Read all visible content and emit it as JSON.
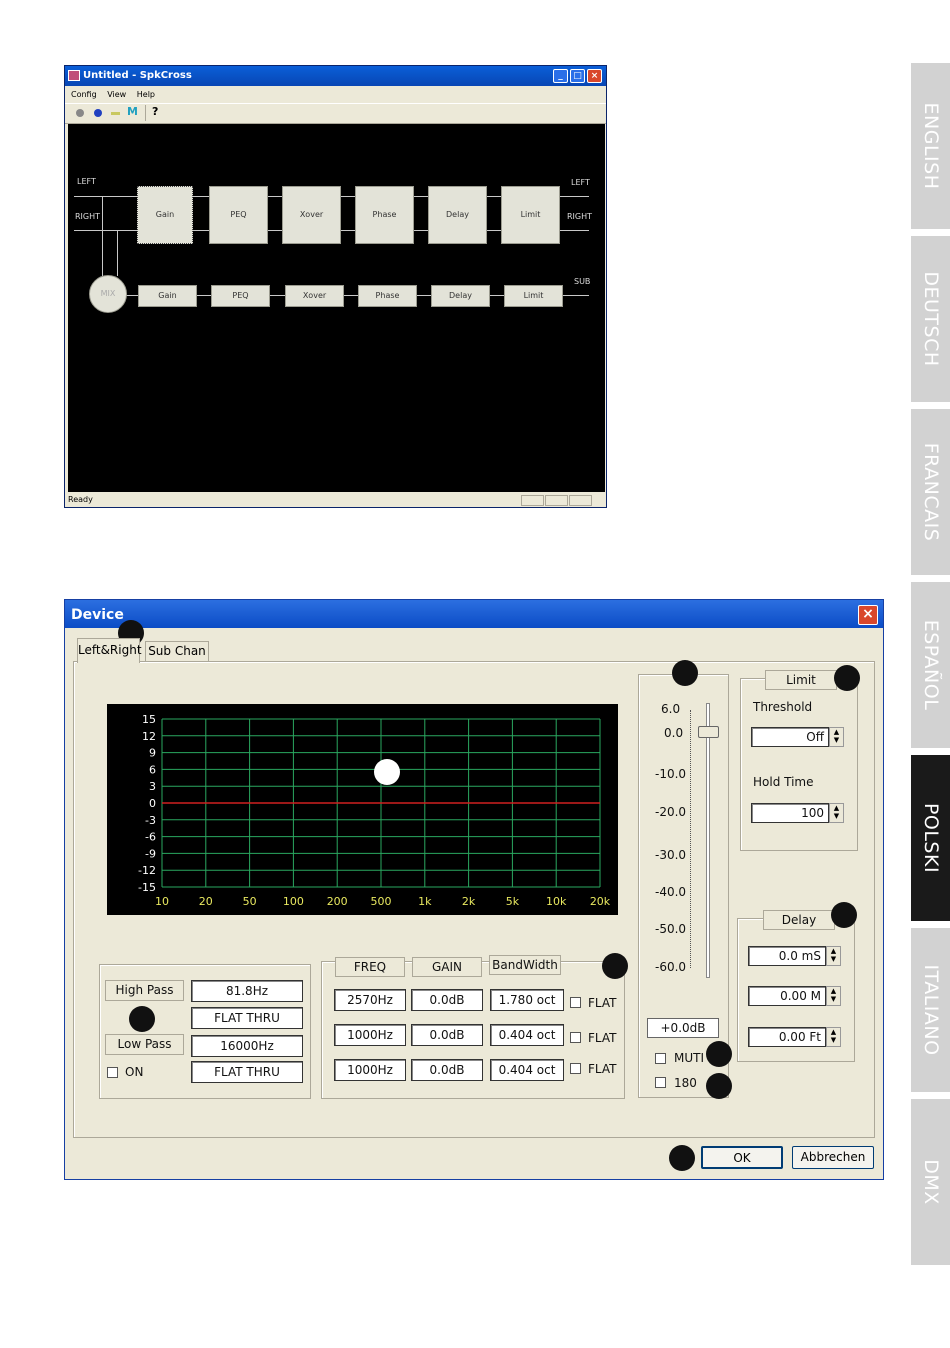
{
  "window1": {
    "title": "Untitled - SpkCross",
    "menu": [
      "Config",
      "View",
      "Help"
    ],
    "toolbar_icons": [
      "gray-circle-icon",
      "blue-circle-icon",
      "yellow-bar-icon",
      "m-icon",
      "help-icon"
    ],
    "labels": {
      "left_in": "LEFT",
      "right_in": "RIGHT",
      "left_out": "LEFT",
      "right_out": "RIGHT",
      "sub_out": "SUB",
      "mix": "MIX"
    },
    "main_chain": [
      "Gain",
      "PEQ",
      "Xover",
      "Phase",
      "Delay",
      "Limit"
    ],
    "sub_chain": [
      "Gain",
      "PEQ",
      "Xover",
      "Phase",
      "Delay",
      "Limit"
    ],
    "status": "Ready"
  },
  "device": {
    "title": "Device",
    "tabs": [
      "Left&Right",
      "Sub Chan"
    ],
    "graph": {
      "y_ticks": [
        "15",
        "12",
        "9",
        "6",
        "3",
        "0",
        "-3",
        "-6",
        "-9",
        "-12",
        "-15"
      ],
      "x_ticks": [
        "10",
        "20",
        "50",
        "100",
        "200",
        "500",
        "1k",
        "2k",
        "5k",
        "10k",
        "20k"
      ],
      "curve_color": "#d02020",
      "grid_color": "#2aa860"
    },
    "filters": {
      "high_pass_label": "High Pass",
      "high_pass_freq": "81.8Hz",
      "high_pass_type": "FLAT THRU",
      "low_pass_label": "Low Pass",
      "low_pass_freq": "16000Hz",
      "low_pass_type": "FLAT THRU",
      "on_label": "ON"
    },
    "peq": {
      "headers": [
        "FREQ",
        "GAIN",
        "BandWidth"
      ],
      "rows": [
        {
          "freq": "2570Hz",
          "gain": "0.0dB",
          "bw": "1.780 oct",
          "flat": "FLAT"
        },
        {
          "freq": "1000Hz",
          "gain": "0.0dB",
          "bw": "0.404 oct",
          "flat": "FLAT"
        },
        {
          "freq": "1000Hz",
          "gain": "0.0dB",
          "bw": "0.404 oct",
          "flat": "FLAT"
        }
      ]
    },
    "gain": {
      "scale": [
        "6.0",
        "0.0",
        "-10.0",
        "-20.0",
        "-30.0",
        "-40.0",
        "-50.0",
        "-60.0"
      ],
      "value": "+0.0dB",
      "mute_label": "MUTI",
      "invert_label": "180"
    },
    "limit": {
      "title": "Limit",
      "threshold_label": "Threshold",
      "threshold_value": "Off",
      "hold_label": "Hold Time",
      "hold_value": "100"
    },
    "delay": {
      "title": "Delay",
      "ms": "0.0 mS",
      "m": "0.00 M",
      "ft": "0.00 Ft"
    },
    "ok_label": "OK",
    "cancel_label": "Abbrechen"
  },
  "side_tabs": [
    "ENGLISH",
    "DEUTSCH",
    "FRANCAIS",
    "ESPAÑOL",
    "POLSKI",
    "ITALIANO",
    "DMX"
  ]
}
